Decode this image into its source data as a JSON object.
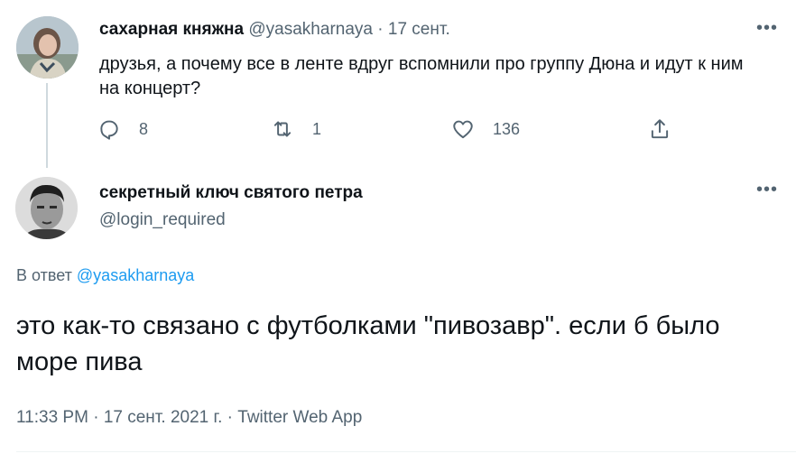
{
  "parent_tweet": {
    "display_name": "сахарная княжна",
    "handle": "@yasakharnaya",
    "separator": "·",
    "date": "17 сент.",
    "more_label": "•••",
    "text": "друзья, а почему все в ленте вдруг вспомнили про группу Дюна и идут к ним на концерт?",
    "replies": "8",
    "retweets": "1",
    "likes": "136"
  },
  "main_tweet": {
    "display_name": "секретный ключ святого петра",
    "handle": "@login_required",
    "more_label": "•••",
    "reply_prefix": "В ответ",
    "reply_to": "@yasakharnaya",
    "text": "это как-то связано с футболками \"пивозавр\". если б было море пива",
    "time": "11:33 PM",
    "date": "17 сент. 2021 г.",
    "source": "Twitter Web App",
    "separator": "·"
  },
  "colors": {
    "text": "#0f1419",
    "muted": "#536471",
    "link": "#1d9bf0",
    "divider": "#eff3f4"
  },
  "icons": {
    "reply": "reply-icon",
    "retweet": "retweet-icon",
    "like": "heart-icon",
    "share": "share-icon",
    "more": "more-icon"
  }
}
